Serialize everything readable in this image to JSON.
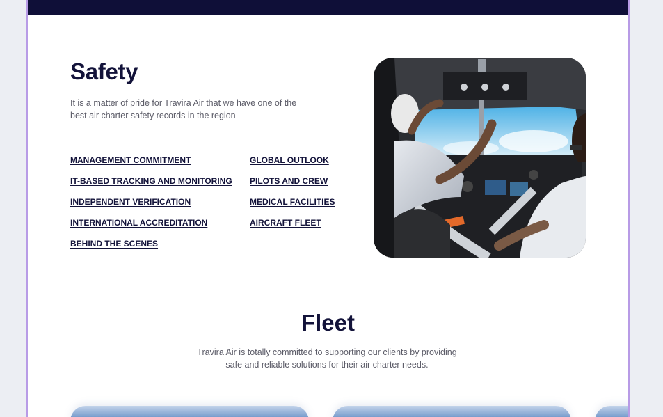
{
  "safety": {
    "title": "Safety",
    "description": "It is a matter of pride for Travira Air that we have one of the best air charter safety records in the region",
    "links_left": [
      "MANAGEMENT COMMITMENT",
      "IT-BASED TRACKING AND MONITORING",
      "INDEPENDENT VERIFICATION",
      "INTERNATIONAL ACCREDITATION",
      "BEHIND THE SCENES"
    ],
    "links_right": [
      "GLOBAL OUTLOOK",
      "PILOTS AND CREW",
      "MEDICAL FACILITIES",
      "AIRCRAFT FLEET"
    ]
  },
  "fleet": {
    "title": "Fleet",
    "description": "Travira Air is totally committed to supporting our clients by providing safe and reliable solutions for their air charter needs."
  },
  "colors": {
    "navy": "#13133a",
    "topbar": "#0f0f38",
    "frame_border": "#b89be6"
  }
}
